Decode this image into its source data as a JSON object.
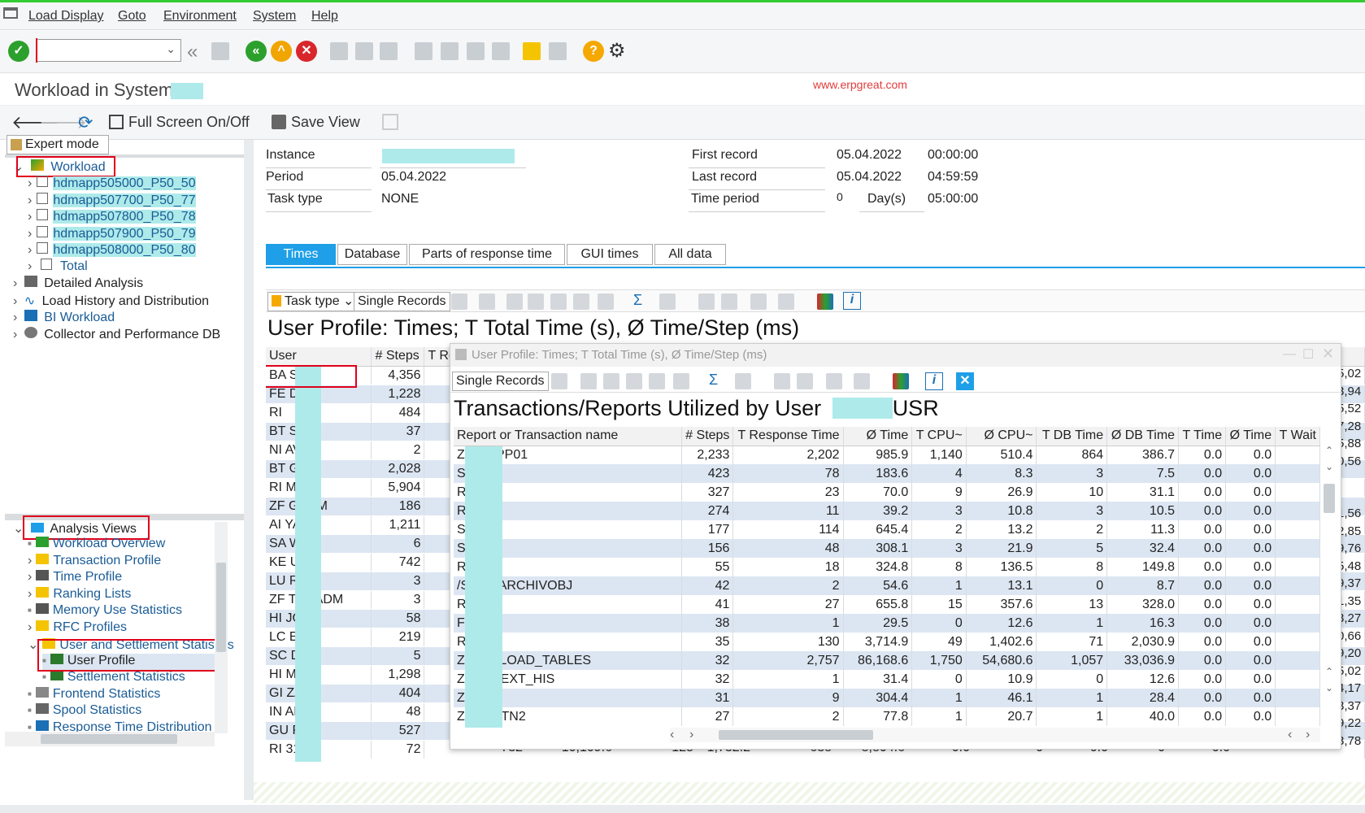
{
  "menu": [
    "Load Display",
    "Goto",
    "Environment",
    "System",
    "Help"
  ],
  "title": "Workload in System",
  "watermark": "www.erpgreat.com",
  "app_toolbar": {
    "fullscreen": "Full Screen On/Off",
    "saveview": "Save View"
  },
  "left": {
    "expert_mode": "Expert mode",
    "workload": "Workload",
    "servers": [
      "hdmapp505000_P50_50",
      "hdmapp507700_P50_77",
      "hdmapp507800_P50_78",
      "hdmapp507900_P50_79",
      "hdmapp508000_P50_80"
    ],
    "total": "Total",
    "other_nodes": [
      "Detailed Analysis",
      "Load History and Distribution",
      "BI Workload",
      "Collector and Performance DB"
    ],
    "analysis_views": "Analysis Views",
    "views": [
      "Workload Overview",
      "Transaction Profile",
      "Time Profile",
      "Ranking Lists",
      "Memory Use Statistics",
      "RFC Profiles",
      "User and Settlement Statistics",
      "User Profile",
      "Settlement Statistics",
      "Frontend Statistics",
      "Spool Statistics",
      "Response Time Distribution"
    ]
  },
  "info": {
    "instance_label": "Instance",
    "period_label": "Period",
    "period": "05.04.2022",
    "tasktype_label": "Task type",
    "tasktype": "NONE",
    "first_label": "First record",
    "first_date": "05.04.2022",
    "first_time": "00:00:00",
    "last_label": "Last record",
    "last_date": "05.04.2022",
    "last_time": "04:59:59",
    "tp_label": "Time period",
    "tp_days": "0",
    "days_label": "Day(s)",
    "tp_time": "05:00:00"
  },
  "tabs": [
    "Times",
    "Database",
    "Parts of response time",
    "GUI times",
    "All data"
  ],
  "grid_toolbar": {
    "tasktype": "Task type",
    "single": "Single Records"
  },
  "grid_title": "User Profile: Times; T Total Time (s), Ø Time/Step (ms)",
  "user_cols": [
    "User",
    "# Steps",
    "T Re"
  ],
  "users": [
    [
      "BA     SR",
      "4,356"
    ],
    [
      "FE     D",
      "1,228"
    ],
    [
      "RI",
      "484"
    ],
    [
      "BT     S1",
      "37"
    ],
    [
      "NI     AV",
      "2"
    ],
    [
      "BT     GP",
      "2,028"
    ],
    [
      "RI     MS",
      "5,904"
    ],
    [
      "ZF     GADM",
      "186"
    ],
    [
      "AI     YA",
      "1,211"
    ],
    [
      "SA     WIN",
      "6"
    ],
    [
      "KE     UA",
      "742"
    ],
    [
      "LU     RN",
      "3"
    ],
    [
      "ZF     TM_ADM",
      "3"
    ],
    [
      "HI     JO",
      "58"
    ],
    [
      "LC     ER",
      "219"
    ],
    [
      "SC     DB",
      "5"
    ],
    [
      "HI     MP",
      "1,298"
    ],
    [
      "GI     ZA",
      "404"
    ],
    [
      "IN     AK",
      "48"
    ],
    [
      "GU     RO",
      "527"
    ],
    [
      "RI     31",
      "72"
    ]
  ],
  "right_edge": [
    "5,02",
    "3,94",
    "5,52",
    "7,28",
    "5,88",
    "0,56",
    "",
    "",
    "1,56",
    "2,85",
    "9,76",
    "5,48",
    "9,37",
    "1,35",
    "3,27",
    "0,66",
    "9,20",
    "5,02",
    "4,17",
    "3,37",
    "9,22",
    "3,78"
  ],
  "last_row_tail": [
    "732",
    "10,109.6",
    "125",
    "1,732.2",
    "638",
    "8,804.6",
    "0.0",
    "0",
    "0.0",
    "0",
    "0.0"
  ],
  "popup": {
    "window_title": "User Profile: Times; T Total Time (s), Ø Time/Step (ms)",
    "single": "Single Records",
    "heading_prefix": "Transactions/Reports Utilized by User",
    "heading_suffix": "USR",
    "cols": [
      "Report or Transaction name",
      "# Steps",
      "T Response Time",
      "Ø Time",
      "T CPU~",
      "Ø CPU~",
      "T DB Time",
      "Ø DB Time",
      "T Time",
      "Ø Time",
      "T Wait"
    ],
    "rows": [
      [
        "ZC     DAPP01",
        "2,233",
        "2,202",
        "985.9",
        "1,140",
        "510.4",
        "864",
        "386.7",
        "0.0",
        "0.0"
      ],
      [
        "SA     FC",
        "423",
        "78",
        "183.6",
        "4",
        "8.3",
        "3",
        "7.5",
        "0.0",
        "0.0"
      ],
      [
        "RS     00",
        "327",
        "23",
        "70.0",
        "9",
        "26.9",
        "10",
        "31.1",
        "0.0",
        "0.0"
      ],
      [
        "RS     TE",
        "274",
        "11",
        "39.2",
        "3",
        "10.8",
        "3",
        "10.5",
        "0.0",
        "0.0"
      ],
      [
        "SA     WK",
        "177",
        "114",
        "645.4",
        "2",
        "13.2",
        "2",
        "11.3",
        "0.0",
        "0.0"
      ],
      [
        "SA     FC",
        "156",
        "48",
        "308.1",
        "3",
        "21.9",
        "5",
        "32.4",
        "0.0",
        "0.0"
      ],
      [
        "RV     T1",
        "55",
        "18",
        "324.8",
        "8",
        "136.5",
        "8",
        "149.8",
        "0.0",
        "0.0"
      ],
      [
        "/S     DS_ARCHIVOBJ",
        "42",
        "2",
        "54.6",
        "1",
        "13.1",
        "0",
        "8.7",
        "0.0",
        "0.0"
      ],
      [
        "RI     30",
        "41",
        "27",
        "655.8",
        "15",
        "357.6",
        "13",
        "328.0",
        "0.0",
        "0.0"
      ],
      [
        "FE",
        "38",
        "1",
        "29.5",
        "0",
        "12.6",
        "1",
        "16.3",
        "0.0",
        "0.0"
      ],
      [
        "RS     00",
        "35",
        "130",
        "3,714.9",
        "49",
        "1,402.6",
        "71",
        "2,030.9",
        "0.0",
        "0.0"
      ],
      [
        "ZC     WNLOAD_TABLES",
        "32",
        "2,757",
        "86,168.6",
        "1,750",
        "54,680.6",
        "1,057",
        "33,036.9",
        "0.0",
        "0.0"
      ],
      [
        "ZC     TA_EXT_HIS",
        "32",
        "1",
        "31.4",
        "0",
        "10.9",
        "0",
        "12.6",
        "0.0",
        "0.0"
      ],
      [
        "ZE     YF",
        "31",
        "9",
        "304.4",
        "1",
        "46.1",
        "1",
        "28.4",
        "0.0",
        "0.0"
      ],
      [
        "ZN     STATN2",
        "27",
        "2",
        "77.8",
        "1",
        "20.7",
        "1",
        "40.0",
        "0.0",
        "0.0"
      ]
    ]
  }
}
